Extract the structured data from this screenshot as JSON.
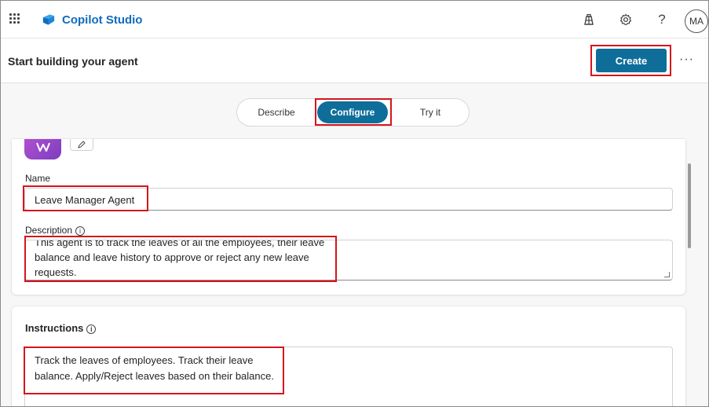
{
  "app": {
    "name": "Copilot Studio",
    "avatar_initials": "MA",
    "icons": [
      "waffle-icon",
      "copilot-studio-logo",
      "environment-icon",
      "settings-icon",
      "help-icon"
    ],
    "help_glyph": "?"
  },
  "header": {
    "title": "Start building your agent",
    "create_label": "Create",
    "more_label": "···"
  },
  "tabs": [
    {
      "label": "Describe",
      "active": false
    },
    {
      "label": "Configure",
      "active": true
    },
    {
      "label": "Try it",
      "active": false
    }
  ],
  "form": {
    "name_label": "Name",
    "name_value": "Leave Manager Agent",
    "description_label": "Description",
    "description_value": "This agent is to track the leaves of all the employees, their leave balance and leave history to approve or reject any new leave requests.",
    "instructions_label": "Instructions",
    "instructions_value": "Track the leaves of employees. Track their leave balance. Apply/Reject leaves based on their balance.",
    "info_glyph": "i"
  },
  "colors": {
    "brand": "#0f6cbd",
    "primary_button": "#0f6e99",
    "highlight": "#d7141d",
    "agent_icon": "#9b46c9"
  }
}
